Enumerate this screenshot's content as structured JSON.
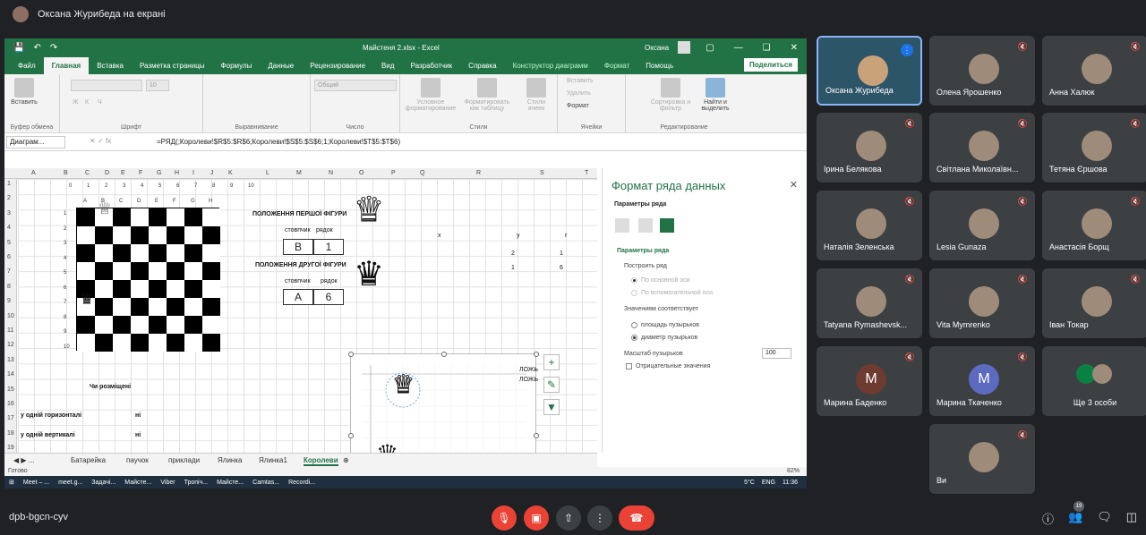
{
  "meet": {
    "presenter_banner": "Оксана Журибеда на екрані",
    "meeting_code": "dpb-bgcn-cyv",
    "people_count": "19"
  },
  "excel": {
    "file_title": "Майстеня 2.xlsx  -  Excel",
    "user": "Оксана",
    "menu": [
      "Файл",
      "Главная",
      "Вставка",
      "Разметка страницы",
      "Формулы",
      "Данные",
      "Рецензирование",
      "Вид",
      "Разработчик",
      "Справка",
      "Конструктор диаграмм",
      "Формат",
      "Помощь"
    ],
    "share_label": "Поделиться",
    "ribbon": {
      "paste": "Вставить",
      "clipboard": "Буфер обмена",
      "font": "Шрифт",
      "alignment": "Выравнивание",
      "number": "Число",
      "number_format": "Общий",
      "font_size": "10",
      "bold": "Ж",
      "italic": "К",
      "underline": "Ч",
      "cond_format": "Условное форматирование",
      "format_as_table": "Форматировать как таблицу",
      "cell_styles": "Стили ячеек",
      "styles": "Стили",
      "insert": "Вставить",
      "delete": "Удалить",
      "format": "Формат",
      "cells": "Ячейки",
      "sort_filter": "Сортировка и фильтр",
      "find_select": "Найти и выделить",
      "editing": "Редактирование"
    },
    "name_box": "Диаграм...",
    "formula": "=РЯД(;Королеви!$R$5:$R$6;Королеви!$S$5:$S$6;1;Королеви!$T$5:$T$6)",
    "columns": [
      "A",
      "B",
      "C",
      "D",
      "E",
      "F",
      "G",
      "H",
      "I",
      "J",
      "K",
      "L",
      "M",
      "N",
      "O",
      "P",
      "Q",
      "R",
      "S",
      "T"
    ],
    "rows": [
      "1",
      "2",
      "3",
      "4",
      "5",
      "6",
      "7",
      "8",
      "9",
      "10",
      "11",
      "12",
      "13",
      "14",
      "15",
      "16",
      "17",
      "18",
      "19"
    ],
    "sheet": {
      "top_nums": [
        "0",
        "1",
        "2",
        "3",
        "4",
        "5",
        "6",
        "7",
        "8",
        "9",
        "10"
      ],
      "left_nums": [
        "1",
        "2",
        "3",
        "4",
        "5",
        "6",
        "7",
        "8",
        "9",
        "10"
      ],
      "board_letters": [
        "A",
        "B",
        "C",
        "D",
        "E",
        "F",
        "G",
        "H"
      ],
      "first_piece_title": "ПОЛОЖЕННЯ ПЕРШОЇ ФІГУРИ",
      "second_piece_title": "ПОЛОЖЕННЯ ДРУГОЇ ФІГУРИ",
      "col_label": "стовпчик",
      "row_label": "рядок",
      "first_col": "B",
      "first_row": "1",
      "second_col": "A",
      "second_row": "6",
      "x_head": "x",
      "y_head": "y",
      "r_head": "r",
      "r5": "2",
      "s5": "1",
      "r6": "1",
      "s6": "6",
      "question": "Чи розміщені",
      "q1": "у  одній горизонталі",
      "a1": "ні",
      "q2": "у одній вертикалі",
      "a2": "ні",
      "chart_false1": "ЛОЖЬ",
      "chart_false2": "ЛОЖЬ"
    },
    "format_pane": {
      "title": "Формат ряда данных",
      "series_options": "Параметры ряда",
      "section": "Параметры ряда",
      "plot_on": "Построить ряд",
      "primary_axis": "По основной оси",
      "secondary_axis": "По вспомогательной оси",
      "values_represent": "Значениям соответствует",
      "bubble_area": "площадь пузырьков",
      "bubble_width": "диаметр пузырьков",
      "scale_label": "Масштаб пузырьков",
      "scale_value": "100",
      "negative_values": "Отрицательные значения"
    },
    "tabs": [
      "Батарейка",
      "паучок",
      "приклади",
      "Ялинка",
      "Ялинка1",
      "Королеви"
    ],
    "status_ready": "Готово",
    "zoom": "82%",
    "taskbar": {
      "items": [
        "Meet – ...",
        "meet.g...",
        "Задачі...",
        "Майсте...",
        "Viber",
        "Тропіч...",
        "Майсте...",
        "Camtas...",
        "Recordi..."
      ],
      "weather": "5°C",
      "lang": "ENG",
      "time": "11:36"
    }
  },
  "participants": [
    {
      "name": "Оксана Журибеда"
    },
    {
      "name": "Олена Ярошенко"
    },
    {
      "name": "Анна Халюк"
    },
    {
      "name": "Ірина Белякова"
    },
    {
      "name": "Світлана Миколаївн..."
    },
    {
      "name": "Тетяна Єршова"
    },
    {
      "name": "Наталія Зеленська"
    },
    {
      "name": "Lesia Gunaza"
    },
    {
      "name": "Анастасія Борщ"
    },
    {
      "name": "Tatyana Rymashevsk..."
    },
    {
      "name": "Vita Mymrenko"
    },
    {
      "name": "Іван Токар"
    },
    {
      "name": "Марина Баденко",
      "initial": "М"
    },
    {
      "name": "Марина Ткаченко",
      "initial": "М"
    },
    {
      "name": "Ще 3 особи"
    },
    {
      "name": "Ви"
    }
  ]
}
